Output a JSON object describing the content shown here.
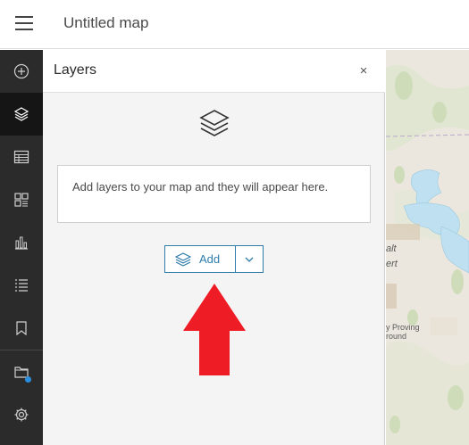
{
  "header": {
    "title": "Untitled map"
  },
  "toolbar": {
    "items": [
      {
        "icon": "add-circle-icon",
        "active": false
      },
      {
        "icon": "layers-icon",
        "active": true
      },
      {
        "icon": "table-icon",
        "active": false
      },
      {
        "icon": "legend-icon",
        "active": false
      },
      {
        "icon": "chart-icon",
        "active": false
      },
      {
        "icon": "list-icon",
        "active": false
      },
      {
        "icon": "bookmark-icon",
        "active": false
      },
      {
        "icon": "map-folder-icon",
        "active": false
      },
      {
        "icon": "gear-icon",
        "active": false
      }
    ]
  },
  "panel": {
    "title": "Layers",
    "close_label": "×",
    "empty_message": "Add layers to your map and they will appear here.",
    "add_label": "Add"
  },
  "map": {
    "labels": {
      "salt": "alt",
      "desert": "ert",
      "proving": "y Proving",
      "ground": "round"
    }
  },
  "colors": {
    "accent": "#2d7cab",
    "toolbar": "#2b2b2b",
    "arrow": "#ee1c25",
    "lake": "#bfe0f0"
  }
}
